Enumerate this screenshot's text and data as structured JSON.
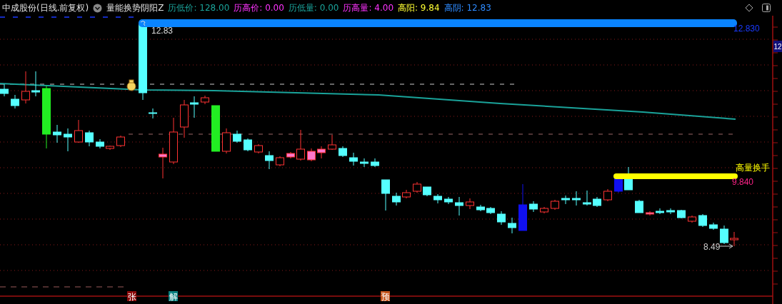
{
  "header": {
    "security": "中成股份(日线.前复权)",
    "indicator": "量能换势阴阳Z",
    "stats": [
      {
        "label": "历低价:",
        "value": "128.00",
        "color": "#1aa39a"
      },
      {
        "label": "历高价:",
        "value": "0.00",
        "color": "#ff33ff"
      },
      {
        "label": "历低量:",
        "value": "0.00",
        "color": "#1aa39a"
      },
      {
        "label": "历高量:",
        "value": "4.00",
        "color": "#ff33ff"
      },
      {
        "label": "高阳:",
        "value": "9.84",
        "color": "#ffff33"
      },
      {
        "label": "高阴:",
        "value": "12.83",
        "color": "#2e8bff"
      }
    ]
  },
  "chart": {
    "high_bar_label": "12.83",
    "high_bar_value": "12.830",
    "volume_label": "高量换手",
    "volume_value": "9.840",
    "last_price_label": "8.49",
    "axis_price_tag": "12",
    "signals": [
      {
        "text": "张",
        "color": "#8b0a0a"
      },
      {
        "text": "解",
        "color": "#0a8080"
      },
      {
        "text": "预",
        "color": "#c4531a"
      }
    ]
  }
}
